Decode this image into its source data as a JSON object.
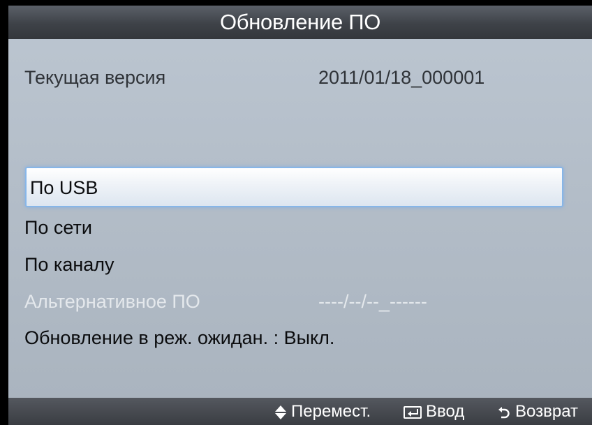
{
  "title": "Обновление ПО",
  "current_version": {
    "label": "Текущая версия",
    "value": "2011/01/18_000001"
  },
  "menu": [
    {
      "label": "По USB",
      "selected": true
    },
    {
      "label": "По сети"
    },
    {
      "label": "По каналу"
    },
    {
      "label": "Альтернативное ПО",
      "value": "----/--/--_------",
      "disabled": true
    },
    {
      "label": "Обновление в реж. ожидан. : Выкл."
    }
  ],
  "footer": {
    "move": {
      "icon": "up-down-arrows-icon",
      "label": "Перемест."
    },
    "enter": {
      "icon": "enter-icon",
      "label": "Ввод"
    },
    "back": {
      "icon": "return-icon",
      "label": "Возврат"
    }
  },
  "colors": {
    "selection_border": "#87b6e8",
    "disabled_text": "#e4e8ec",
    "titlebar": "#3e4248"
  }
}
